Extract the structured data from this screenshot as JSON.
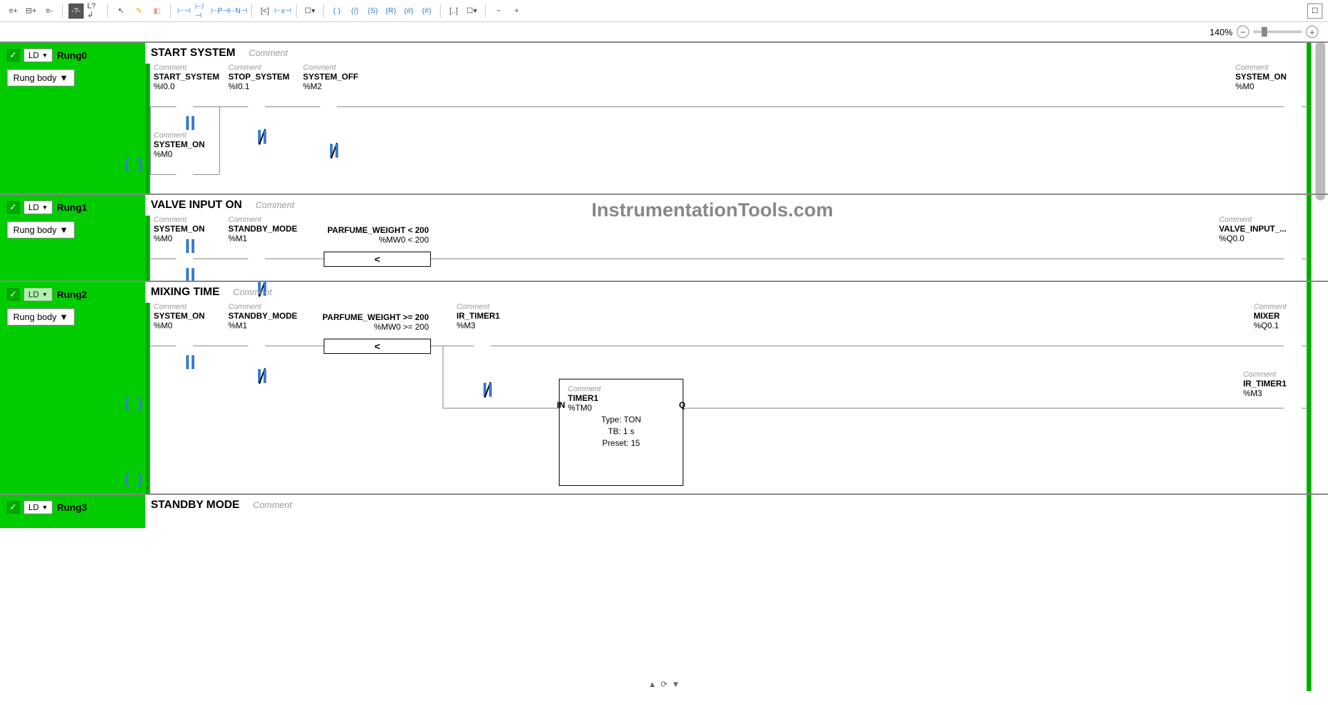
{
  "zoom": {
    "percent": "140%"
  },
  "watermark": "InstrumentationTools.com",
  "rung_body_label": "Rung body",
  "ld_label": "LD",
  "rungs": [
    {
      "name": "Rung0",
      "title": "START SYSTEM",
      "title_comment": "Comment",
      "elements": {
        "e1": {
          "comment": "Comment",
          "name": "START_SYSTEM",
          "addr": "%I0.0"
        },
        "e2": {
          "comment": "Comment",
          "name": "STOP_SYSTEM",
          "addr": "%I0.1"
        },
        "e3": {
          "comment": "Comment",
          "name": "SYSTEM_OFF",
          "addr": "%M2"
        },
        "e4": {
          "comment": "Comment",
          "name": "SYSTEM_ON",
          "addr": "%M0"
        },
        "out": {
          "comment": "Comment",
          "name": "SYSTEM_ON",
          "addr": "%M0"
        }
      }
    },
    {
      "name": "Rung1",
      "title": "VALVE INPUT ON",
      "title_comment": "Comment",
      "elements": {
        "e1": {
          "comment": "Comment",
          "name": "SYSTEM_ON",
          "addr": "%M0"
        },
        "e2": {
          "comment": "Comment",
          "name": "STANDBY_MODE",
          "addr": "%M1"
        },
        "cmp": {
          "label": "PARFUME_WEIGHT < 200",
          "expr": "%MW0 < 200",
          "op": "<"
        },
        "out": {
          "comment": "Comment",
          "name": "VALVE_INPUT_...",
          "addr": "%Q0.0"
        }
      }
    },
    {
      "name": "Rung2",
      "title": "MIXING TIME",
      "title_comment": "Comment",
      "elements": {
        "e1": {
          "comment": "Comment",
          "name": "SYSTEM_ON",
          "addr": "%M0"
        },
        "e2": {
          "comment": "Comment",
          "name": "STANDBY_MODE",
          "addr": "%M1"
        },
        "cmp": {
          "label": "PARFUME_WEIGHT >= 200",
          "expr": "%MW0 >= 200",
          "op": "<"
        },
        "e3": {
          "comment": "Comment",
          "name": "IR_TIMER1",
          "addr": "%M3"
        },
        "out1": {
          "comment": "Comment",
          "name": "MIXER",
          "addr": "%Q0.1"
        },
        "timer": {
          "comment": "Comment",
          "name": "TIMER1",
          "addr": "%TM0",
          "type_label": "Type:",
          "type": "TON",
          "tb_label": "TB:",
          "tb": "1 s",
          "preset_label": "Preset:",
          "preset": "15",
          "in": "IN",
          "q": "Q"
        },
        "out2": {
          "comment": "Comment",
          "name": "IR_TIMER1",
          "addr": "%M3"
        }
      }
    },
    {
      "name": "Rung3",
      "title": "STANDBY MODE",
      "title_comment": "Comment"
    }
  ]
}
